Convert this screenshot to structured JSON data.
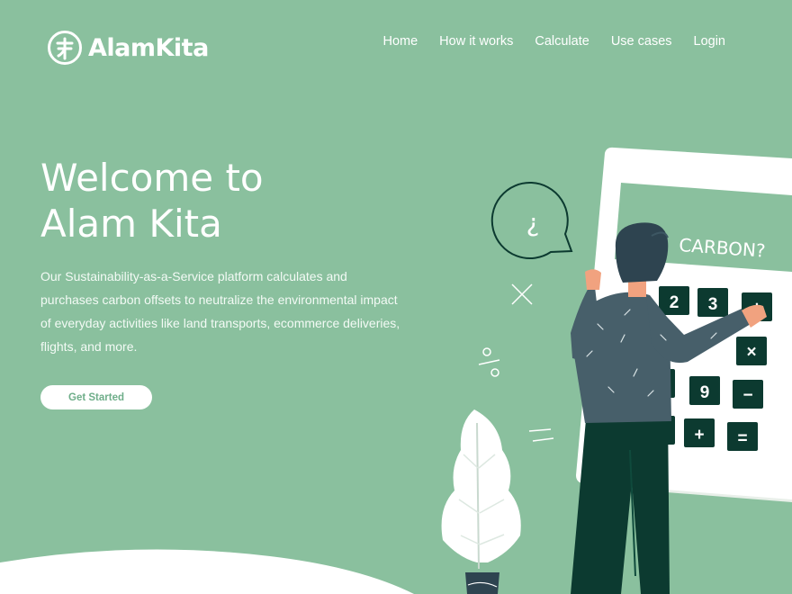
{
  "brand": {
    "name": "AlamKita",
    "logo_icon": "tree-glyph-icon"
  },
  "nav": {
    "items": [
      "Home",
      "How it works",
      "Calculate",
      "Use cases",
      "Login"
    ]
  },
  "hero": {
    "title_line1": "Welcome to",
    "title_line2": "Alam Kita",
    "description": "Our Sustainability-as-a-Service platform calculates and purchases carbon offsets to neutralize the environmental impact of everyday activities like land transports, ecommerce deliveries, flights, and more.",
    "cta_label": "Get Started"
  },
  "illustration": {
    "screen_text": "CARBON?",
    "speech_bubble": "¿",
    "keys": [
      "2",
      "3",
      "÷",
      "×",
      "9",
      "−",
      "+",
      "="
    ]
  },
  "colors": {
    "background": "#8ac09e",
    "accent": "#6fae8a",
    "dark": "#0c3a30",
    "shirt": "#475f6a"
  }
}
